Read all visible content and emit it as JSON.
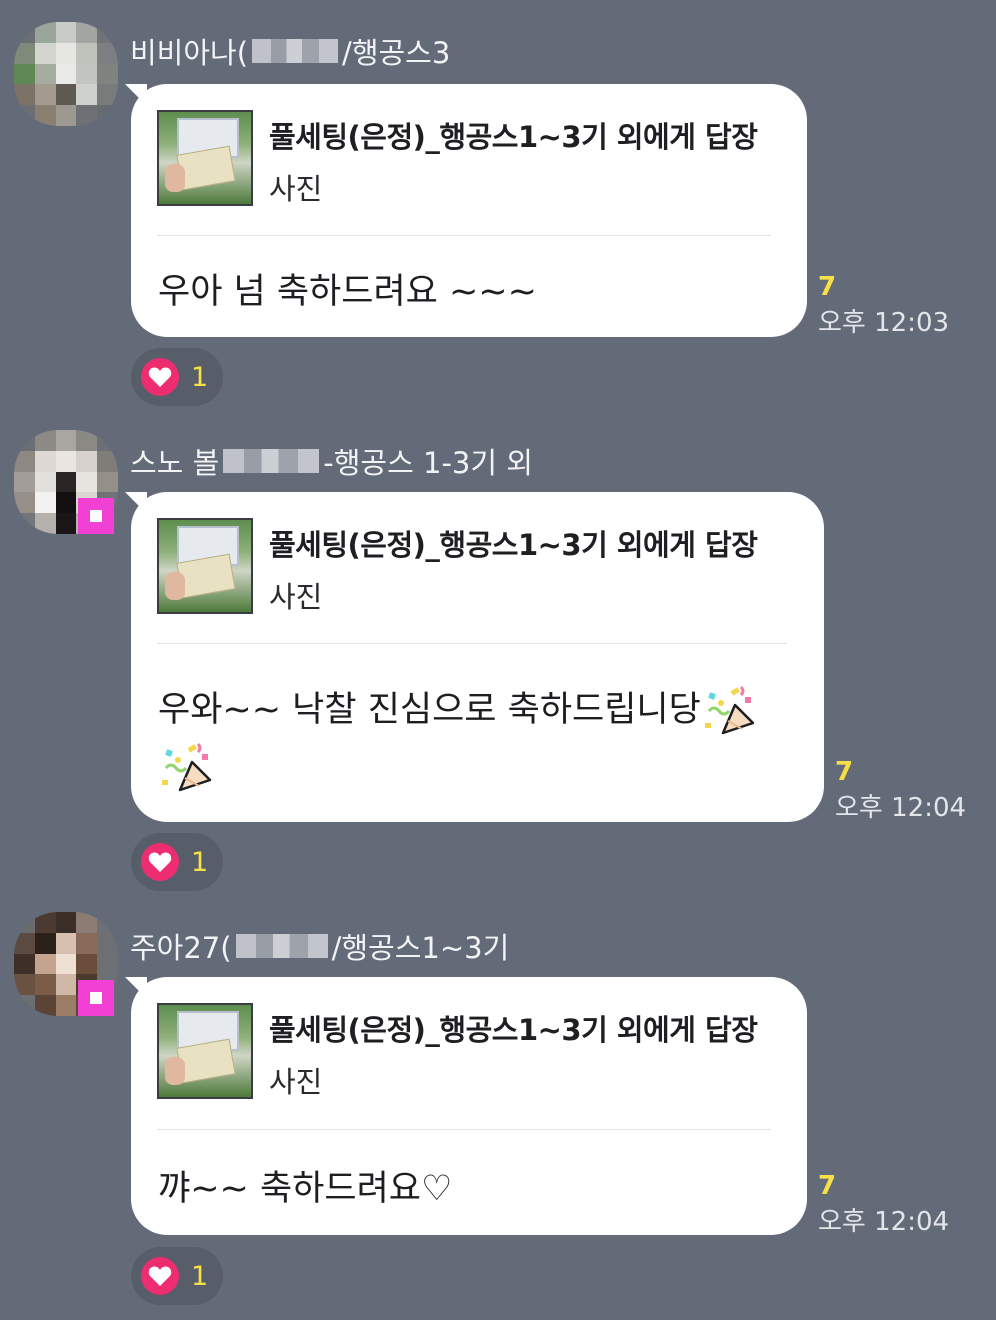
{
  "messages": [
    {
      "sender_prefix": "비비아나(",
      "sender_suffix": "/행공스3",
      "reply_title": "풀세팅(은정)_행공스1~3기 외에게 답장",
      "reply_type": "사진",
      "text": "우아 넘 축하드려요 ~~~",
      "unread_count": "7",
      "time": "오후 12:03",
      "reaction_count": "1",
      "avatar_colors": [
        "#6b6e74",
        "#9aa69a",
        "#c9cbc6",
        "#a2a5a2",
        "#707378",
        "#7e8a7a",
        "#d3d6cf",
        "#e6e7e3",
        "#bfc3bb",
        "#7b7f82",
        "#5f8a55",
        "#a7aca0",
        "#eaebe6",
        "#c3c6c0",
        "#80847f",
        "#7d7266",
        "#a39b8f",
        "#5e5a52",
        "#cfd2cc",
        "#777b7c",
        "#6b6f73",
        "#8a8072",
        "#9c9990",
        "#6d7175",
        "#676b70"
      ]
    },
    {
      "sender_prefix": "스노 볼",
      "sender_suffix": "-행공스 1-3기 외",
      "reply_title": "풀세팅(은정)_행공스1~3기 외에게 답장",
      "reply_type": "사진",
      "text_line1": "우와~~ 낙찰 진심으로 축하드립니당",
      "unread_count": "7",
      "time": "오후 12:04",
      "reaction_count": "1",
      "avatar_colors": [
        "#6a6f75",
        "#8d8a86",
        "#a9a6a1",
        "#8b8984",
        "#6c7076",
        "#8e8882",
        "#ded9d4",
        "#e9e6e2",
        "#d6d1cc",
        "#807c78",
        "#a39d97",
        "#e2e0dd",
        "#2a2424",
        "#e7e4e0",
        "#948f89",
        "#958f88",
        "#f4f2f0",
        "#121010",
        "#d9d5d1",
        "#6f7276",
        "#737679",
        "#b4b0ab",
        "#1a1616",
        "#b7b3ae",
        "#6e7176"
      ]
    },
    {
      "sender_prefix": "주아27(",
      "sender_suffix": "/행공스1~3기",
      "reply_title": "풀세팅(은정)_행공스1~3기 외에게 답장",
      "reply_type": "사진",
      "text": "꺄~~ 축하드려요♡",
      "unread_count": "7",
      "time": "오후 12:04",
      "reaction_count": "1",
      "avatar_colors": [
        "#6b6a6c",
        "#4a3a32",
        "#3c2e28",
        "#8d7c73",
        "#6c6f74",
        "#5a4a40",
        "#2c201b",
        "#d7c0b0",
        "#8a6a58",
        "#6e6f73",
        "#3e2f28",
        "#c4a48f",
        "#efe0d4",
        "#6b4d3c",
        "#6d6f73",
        "#6a5242",
        "#7a5c48",
        "#d1b7a5",
        "#4d3a2f",
        "#6c6f73",
        "#6c6e72",
        "#5b4436",
        "#9b7d68",
        "#5e4538",
        "#6c6f73"
      ]
    }
  ],
  "icons": {
    "reaction": "heart-icon",
    "party": "party-popper-icon"
  }
}
